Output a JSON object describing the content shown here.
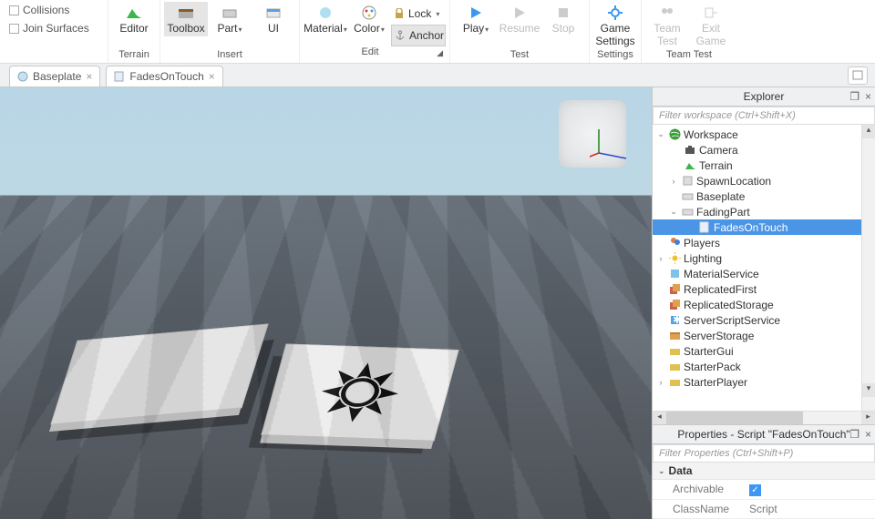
{
  "ribbon": {
    "checks": {
      "collisions": "Collisions",
      "join": "Join Surfaces"
    },
    "editor": "Editor",
    "toolbox": "Toolbox",
    "part": "Part",
    "ui": "UI",
    "terrain": "Terrain",
    "insert_group": "Insert",
    "material": "Material",
    "color": "Color",
    "lock": "Lock",
    "anchor": "Anchor",
    "edit_group": "Edit",
    "play": "Play",
    "resume": "Resume",
    "stop": "Stop",
    "test_group": "Test",
    "game_settings": "Game\nSettings",
    "settings_group": "Settings",
    "team_test": "Team\nTest",
    "exit_game": "Exit\nGame",
    "teamtest_group": "Team Test"
  },
  "tabs": {
    "baseplate": "Baseplate",
    "script": "FadesOnTouch"
  },
  "explorer": {
    "title": "Explorer",
    "filter_placeholder": "Filter workspace (Ctrl+Shift+X)",
    "nodes": {
      "workspace": "Workspace",
      "camera": "Camera",
      "terrain": "Terrain",
      "spawn": "SpawnLocation",
      "baseplate": "Baseplate",
      "fadingpart": "FadingPart",
      "fades": "FadesOnTouch",
      "players": "Players",
      "lighting": "Lighting",
      "materialservice": "MaterialService",
      "repfirst": "ReplicatedFirst",
      "repstorage": "ReplicatedStorage",
      "sss": "ServerScriptService",
      "sstorage": "ServerStorage",
      "startergui": "StarterGui",
      "starterpack": "StarterPack",
      "starterplayer": "StarterPlayer"
    }
  },
  "properties": {
    "title": "Properties - Script \"FadesOnTouch\"",
    "filter_placeholder": "Filter Properties (Ctrl+Shift+P)",
    "cat_data": "Data",
    "archivable": "Archivable",
    "classname": "ClassName",
    "classname_val": "Script"
  }
}
